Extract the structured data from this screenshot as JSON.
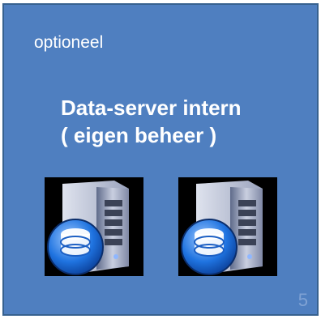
{
  "card": {
    "optional_label": "optioneel",
    "title_line1": "Data-server intern",
    "title_line2": "( eigen beheer )",
    "page_number": "5"
  },
  "icons": [
    "database-server-icon",
    "database-server-icon"
  ],
  "colors": {
    "card_background": "#4f7fc0",
    "card_border": "#37618f",
    "text": "#ffffff",
    "page_number": "#7fa2d4"
  }
}
